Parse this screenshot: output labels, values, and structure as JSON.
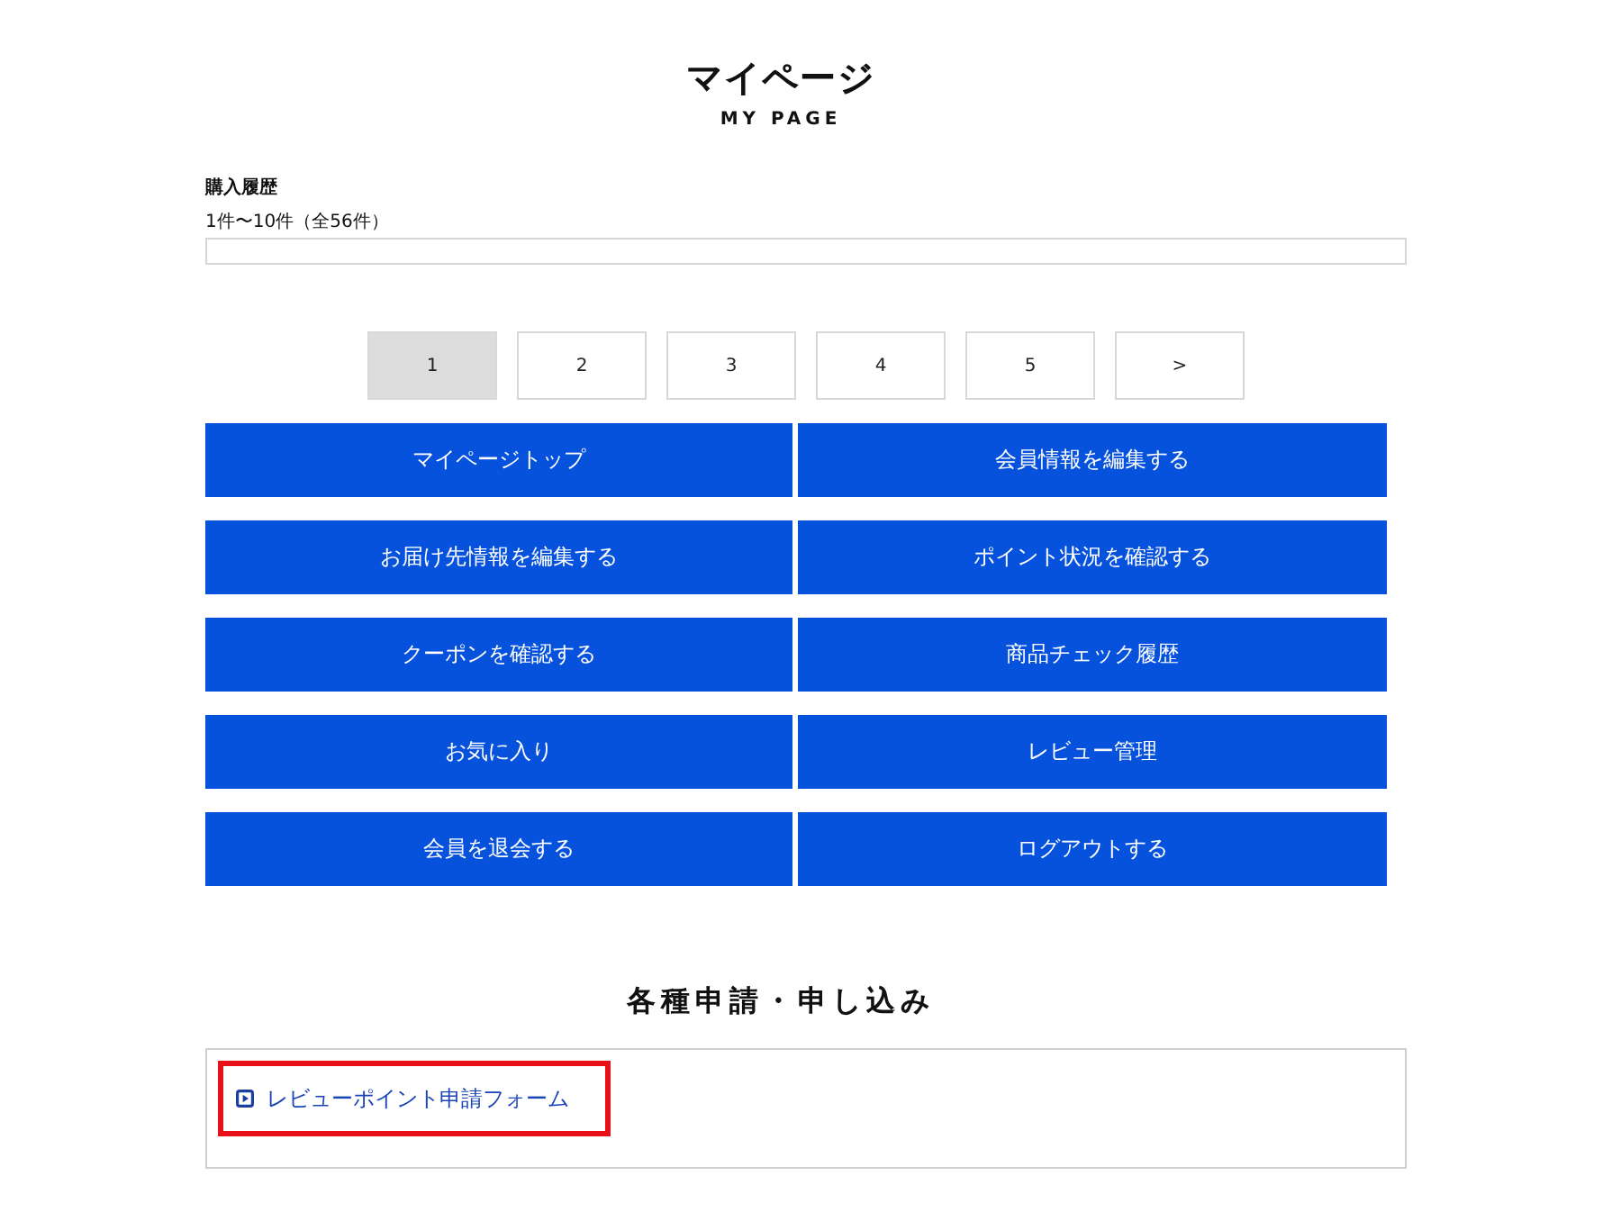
{
  "page": {
    "title": "マイページ",
    "subtitle": "MY PAGE"
  },
  "purchase_history": {
    "heading": "購入履歴",
    "count": "1件〜10件（全56件）"
  },
  "pagination": [
    {
      "label": "1",
      "selected": true
    },
    {
      "label": "2",
      "selected": false
    },
    {
      "label": "3",
      "selected": false
    },
    {
      "label": "4",
      "selected": false
    },
    {
      "label": "5",
      "selected": false
    },
    {
      "label": ">",
      "selected": false
    }
  ],
  "menu_buttons": [
    "マイページトップ",
    "会員情報を編集する",
    "お届け先情報を編集する",
    "ポイント状況を確認する",
    "クーポンを確認する",
    "商品チェック履歴",
    "お気に入り",
    "レビュー管理",
    "会員を退会する",
    "ログアウトする"
  ],
  "applications": {
    "heading": "各種申請・申し込み",
    "links": [
      {
        "label": "レビューポイント申請フォーム",
        "highlighted": true
      }
    ]
  }
}
